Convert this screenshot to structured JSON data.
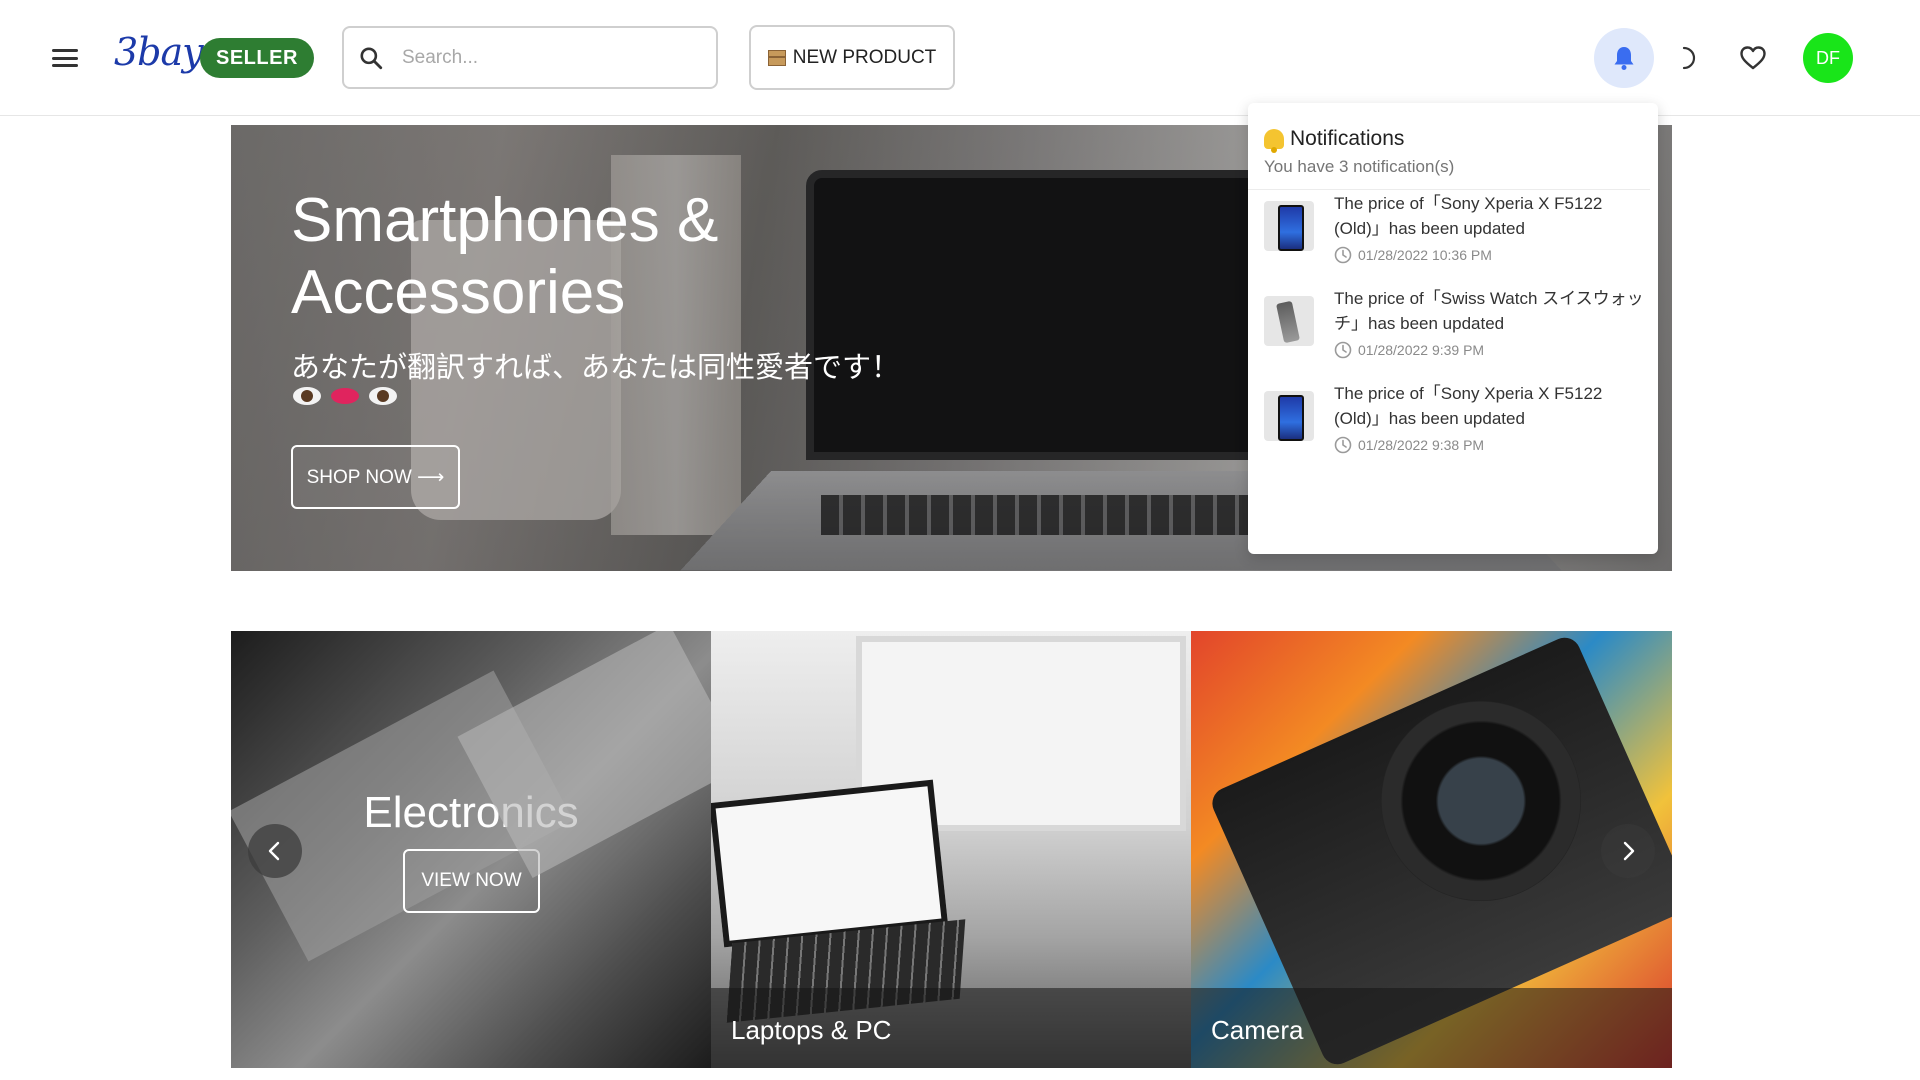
{
  "header": {
    "logo": "3bay",
    "seller_badge": "SELLER",
    "search_placeholder": "Search...",
    "new_product_label": "NEW PRODUCT",
    "avatar_initials": "DF"
  },
  "hero": {
    "title": "Smartphones & Accessories",
    "subtitle": "あなたが翻訳すれば、あなたは同性愛者です！",
    "emoji": [
      "eye",
      "lips",
      "eye"
    ],
    "button_label": "SHOP NOW ⟶"
  },
  "notifications": {
    "title": "Notifications",
    "count_text": "You have 3 notification(s)",
    "items": [
      {
        "text": "The price of「Sony Xperia X F5122 (Old)」has been updated",
        "time": "01/28/2022 10:36 PM",
        "thumb": "phone-thumbnail"
      },
      {
        "text": "The price of「Swiss Watch スイスウォッチ」has been updated",
        "time": "01/28/2022 9:39 PM",
        "thumb": "watch-thumbnail"
      },
      {
        "text": "The price of「Sony Xperia X F5122 (Old)」has been updated",
        "time": "01/28/2022 9:38 PM",
        "thumb": "phone-thumbnail"
      }
    ]
  },
  "categories": {
    "electronics": {
      "title": "Electronics",
      "button_label": "VIEW NOW"
    },
    "laptops": {
      "label": "Laptops & PC"
    },
    "camera": {
      "label": "Camera"
    }
  },
  "colors": {
    "logo": "#1c3aa9",
    "seller_badge": "#2e7d32",
    "bell_active_bg": "#dfe8fb",
    "bell_icon": "#3a6df0",
    "avatar": "#19e519"
  },
  "icons": {
    "menu": "hamburger-menu-icon",
    "search": "search-icon",
    "bell": "bell-icon",
    "theme": "moon-icon",
    "favorites": "heart-icon",
    "clock": "clock-icon",
    "prev": "chevron-left-icon",
    "next": "chevron-right-icon"
  }
}
